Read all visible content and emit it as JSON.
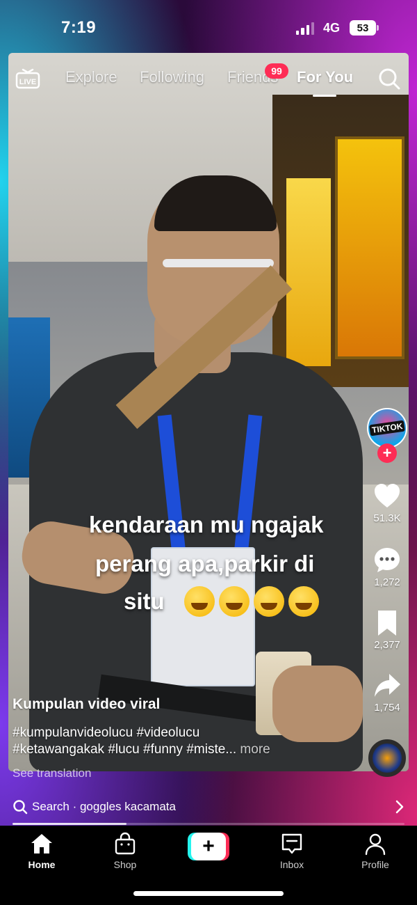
{
  "status_bar": {
    "time": "7:19",
    "network": "4G",
    "battery": "53"
  },
  "top_tabs": {
    "live_label": "LIVE",
    "tabs": [
      "Explore",
      "Following",
      "Friends",
      "For You"
    ],
    "active_tab": "For You",
    "friends_badge": "99"
  },
  "overlay_caption": {
    "line1": "kendaraan mu ngajak",
    "line2": "perang  apa,parkir di",
    "line3": "situ"
  },
  "creator": {
    "avatar_text": "TIKTOK"
  },
  "actions": {
    "likes": "51.3K",
    "comments": "1,272",
    "saves": "2,377",
    "shares": "1,754"
  },
  "post": {
    "author": "Kumpulan video viral",
    "hashtags_line1": "#kumpulanvideolucu #videolucu",
    "hashtags_line2": "#ketawangakak #lucu #funny #miste...",
    "more_label": "more",
    "see_translation": "See translation"
  },
  "search_strip": {
    "text": "Search · goggles kacamata"
  },
  "video_progress": 0.29,
  "bottom_nav": {
    "home": "Home",
    "shop": "Shop",
    "inbox": "Inbox",
    "profile": "Profile"
  },
  "colors": {
    "accent_pink": "#fe2c55",
    "accent_cyan": "#25f4ee"
  }
}
